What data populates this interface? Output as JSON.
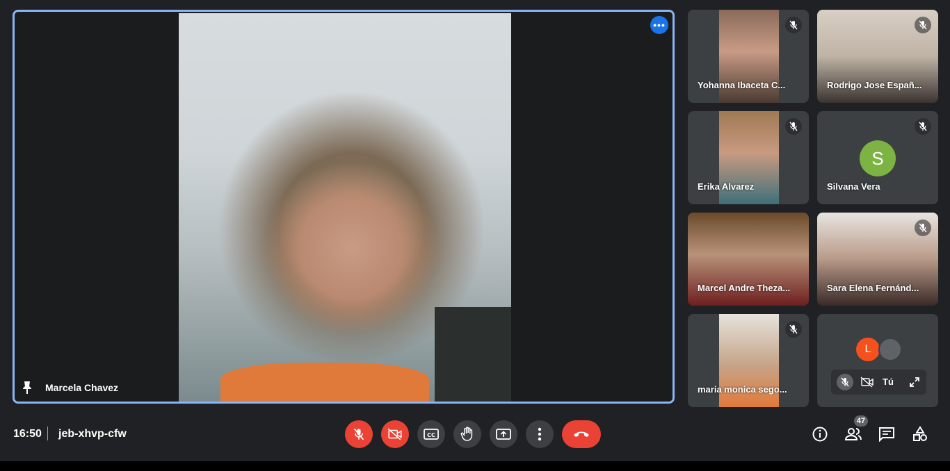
{
  "main": {
    "participant_name": "Marcela Chavez",
    "more_options_icon": "more-horiz-icon",
    "pin_icon": "pin-icon"
  },
  "tiles": [
    {
      "name": "Yohanna Ibaceta C...",
      "muted": true
    },
    {
      "name": "Rodrigo Jose Españ...",
      "muted": true
    },
    {
      "name": "Erika Alvarez",
      "muted": true
    },
    {
      "name": "Silvana Vera",
      "muted": true,
      "avatar_letter": "S",
      "avatar_color": "#7cb342"
    },
    {
      "name": "Marcel Andre Theza...",
      "muted": false
    },
    {
      "name": "Sara Elena Fernánd...",
      "muted": true
    },
    {
      "name": "maria monica sego...",
      "muted": true
    }
  ],
  "self_tile": {
    "avatar_letter": "L",
    "avatar_color": "#f4511e",
    "label": "Tú"
  },
  "bottom_bar": {
    "time": "16:50",
    "meeting_code": "jeb-xhvp-cfw",
    "participants_count": "47"
  },
  "colors": {
    "background": "#202124",
    "tile": "#3c4043",
    "active_border": "#8ab4f8",
    "danger": "#ea4335",
    "accent": "#1a73e8"
  }
}
